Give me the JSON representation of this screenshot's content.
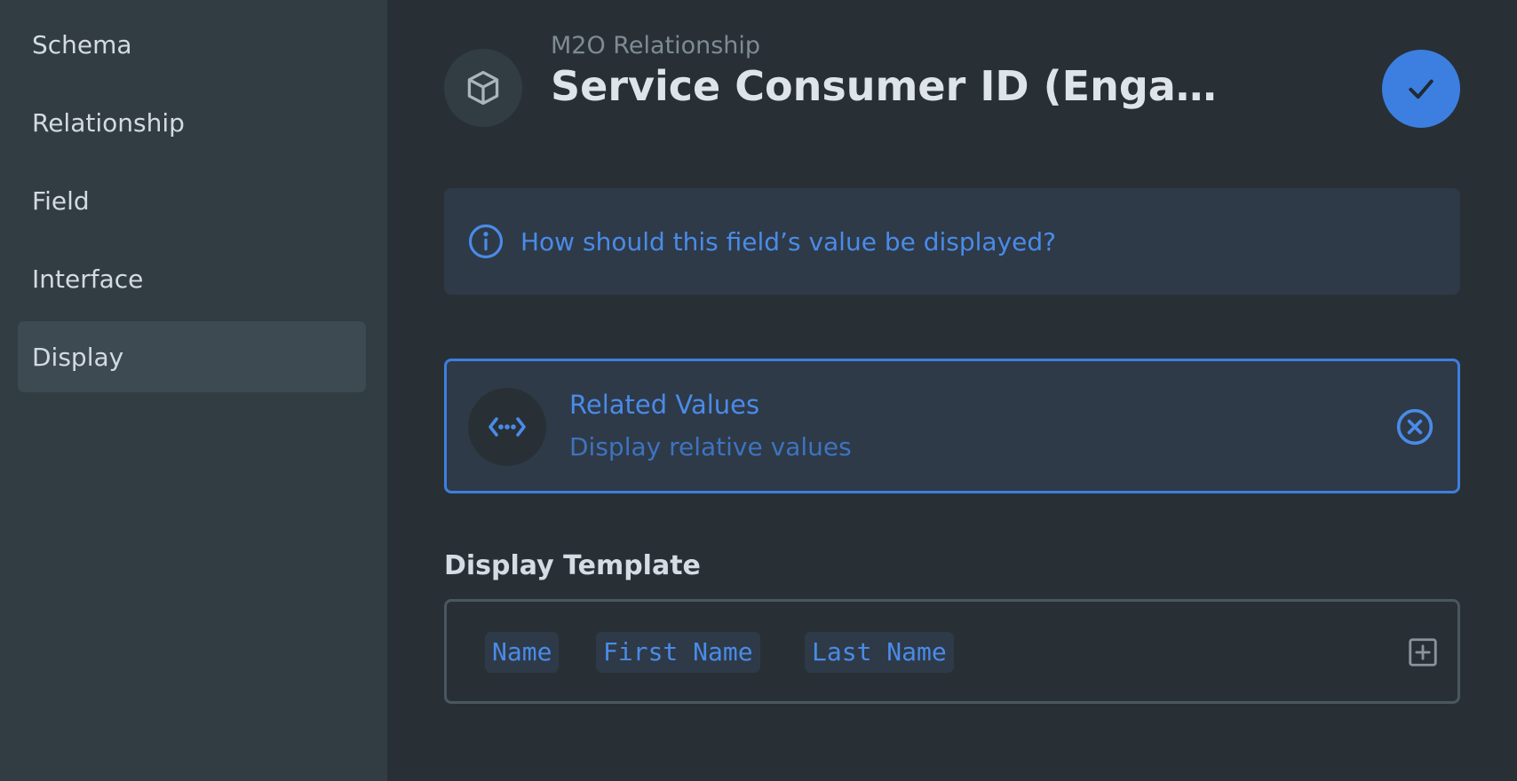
{
  "sidebar": {
    "items": [
      {
        "label": "Schema"
      },
      {
        "label": "Relationship"
      },
      {
        "label": "Field"
      },
      {
        "label": "Interface"
      },
      {
        "label": "Display"
      }
    ],
    "active": "Display"
  },
  "header": {
    "subtitle": "M2O Relationship",
    "title": "Service Consumer ID (Engagement)",
    "icon": "box-icon",
    "save_icon": "check-icon"
  },
  "notice": {
    "icon": "info-icon",
    "text": "How should this field’s value be displayed?"
  },
  "display_card": {
    "icon": "related-values-icon",
    "title": "Related Values",
    "description": "Display relative values",
    "close_icon": "close-circle-icon"
  },
  "display_template": {
    "label": "Display Template",
    "chips": [
      "Name",
      "First Name",
      "Last Name"
    ],
    "add_icon": "add-box-icon"
  },
  "colors": {
    "background": "#283036",
    "sidebar": "#323d43",
    "accent": "#3d7fe0",
    "accent_text": "#4a8be8"
  }
}
